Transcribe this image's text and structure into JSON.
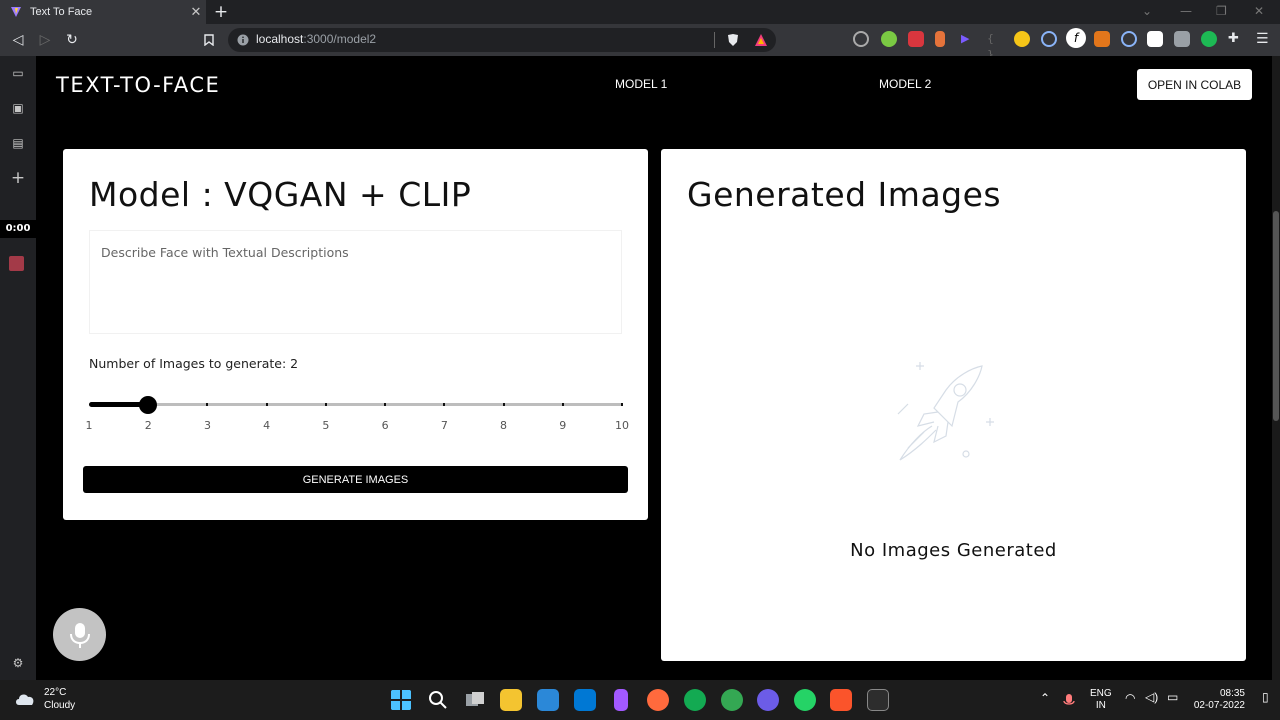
{
  "browser": {
    "tab_title": "Text To Face",
    "url_host": "localhost",
    "url_path": ":3000/model2"
  },
  "sidebar": {
    "timer": "0:00"
  },
  "navbar": {
    "brand": "TEXT-TO-FACE",
    "links": [
      "MODEL 1",
      "MODEL 2"
    ],
    "colab_button": "OPEN IN COLAB"
  },
  "model_card": {
    "title": "Model : VQGAN + CLIP",
    "prompt_placeholder": "Describe Face with Textual Descriptions",
    "count_label": "Number of Images to generate: 2",
    "slider": {
      "min": 1,
      "max": 10,
      "value": 2,
      "marks": [
        "1",
        "2",
        "3",
        "4",
        "5",
        "6",
        "7",
        "8",
        "9",
        "10"
      ]
    },
    "generate_button": "GENERATE IMAGES"
  },
  "results_card": {
    "title": "Generated Images",
    "empty_message": "No Images Generated"
  },
  "taskbar": {
    "temperature": "22°C",
    "condition": "Cloudy",
    "language": "ENG",
    "region": "IN",
    "time": "08:35",
    "date": "02-07-2022"
  },
  "colors": {
    "accent": "#000000",
    "card": "#ffffff",
    "recording": "#a33a48"
  }
}
